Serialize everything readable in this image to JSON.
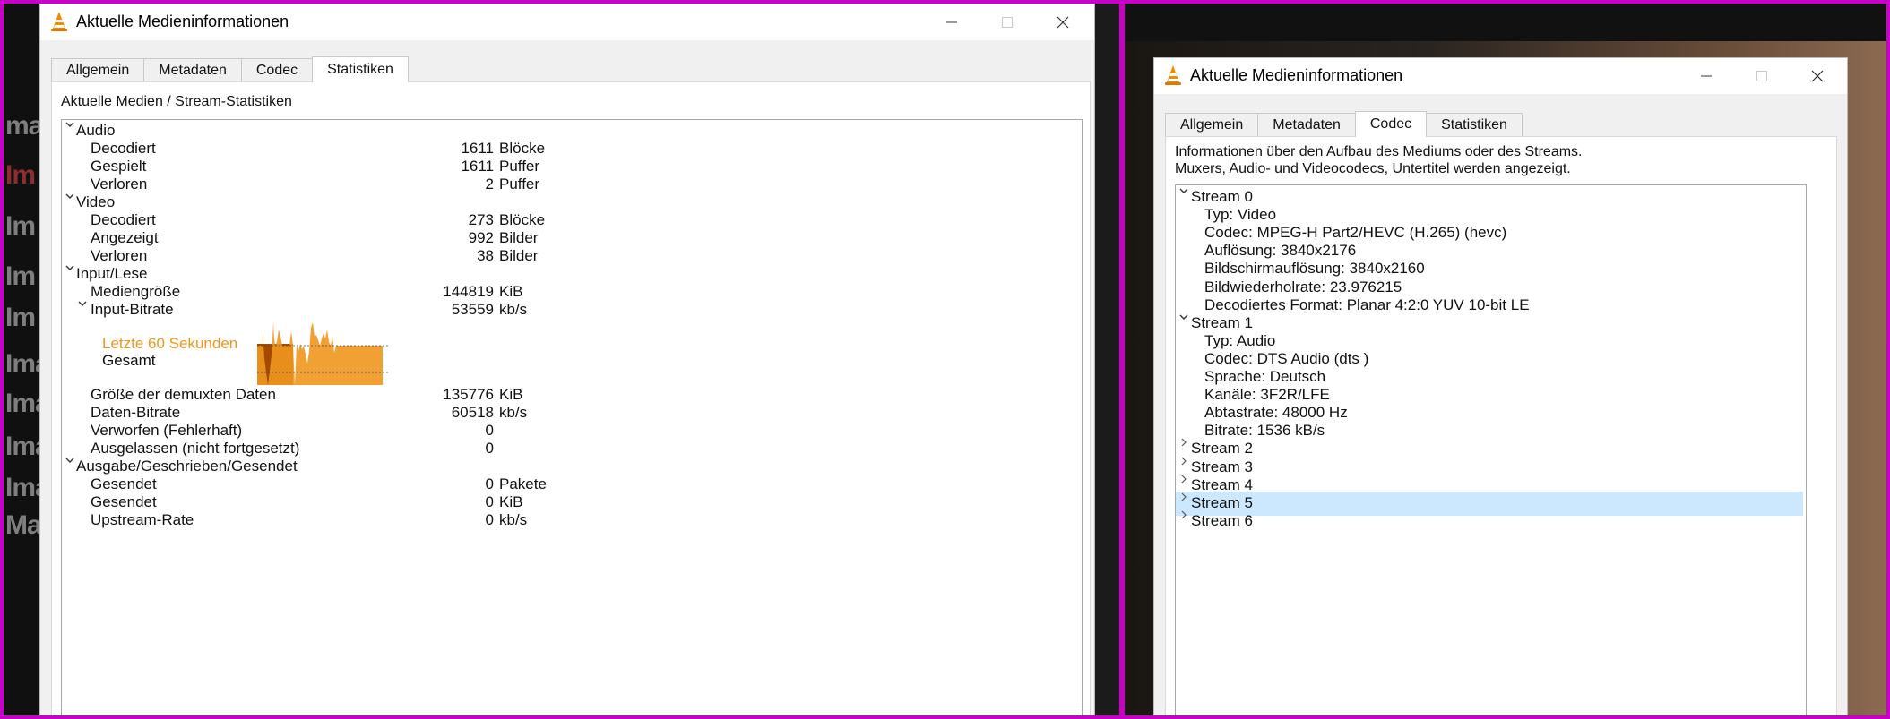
{
  "left_window": {
    "title": "Aktuelle Medieninformationen",
    "tabs": [
      "Allgemein",
      "Metadaten",
      "Codec",
      "Statistiken"
    ],
    "active_tab": "Statistiken",
    "section_title": "Aktuelle Medien / Stream-Statistiken",
    "groups": {
      "audio": {
        "label": "Audio",
        "rows": [
          {
            "label": "Decodiert",
            "value": "1611",
            "unit": "Blöcke"
          },
          {
            "label": "Gespielt",
            "value": "1611",
            "unit": "Puffer"
          },
          {
            "label": "Verloren",
            "value": "2",
            "unit": "Puffer"
          }
        ]
      },
      "video": {
        "label": "Video",
        "rows": [
          {
            "label": "Decodiert",
            "value": "273",
            "unit": "Blöcke"
          },
          {
            "label": "Angezeigt",
            "value": "992",
            "unit": "Bilder"
          },
          {
            "label": "Verloren",
            "value": "38",
            "unit": "Bilder"
          }
        ]
      },
      "input": {
        "label": "Input/Lese",
        "media_size": {
          "label": "Mediengröße",
          "value": "144819",
          "unit": "KiB"
        },
        "bitrate": {
          "label": "Input-Bitrate",
          "value": "53559",
          "unit": "kb/s"
        },
        "legend_recent": "Letzte 60 Sekunden",
        "legend_total": "Gesamt",
        "rows": [
          {
            "label": "Größe der demuxten Daten",
            "value": "135776",
            "unit": "KiB"
          },
          {
            "label": "Daten-Bitrate",
            "value": "60518",
            "unit": "kb/s"
          },
          {
            "label": "Verworfen (Fehlerhaft)",
            "value": "0",
            "unit": ""
          },
          {
            "label": "Ausgelassen (nicht fortgesetzt)",
            "value": "0",
            "unit": ""
          }
        ]
      },
      "output": {
        "label": "Ausgabe/Geschrieben/Gesendet",
        "rows": [
          {
            "label": "Gesendet",
            "value": "0",
            "unit": "Pakete"
          },
          {
            "label": "Gesendet",
            "value": "0",
            "unit": "KiB"
          },
          {
            "label": "Upstream-Rate",
            "value": "0",
            "unit": "kb/s"
          }
        ]
      }
    }
  },
  "background_text": [
    "mag",
    "Im",
    "Im",
    "Im",
    "Im",
    "Ima",
    "Ima",
    "Ima",
    "Ima",
    "Ma"
  ],
  "right_window": {
    "title": "Aktuelle Medieninformationen",
    "tabs": [
      "Allgemein",
      "Metadaten",
      "Codec",
      "Statistiken"
    ],
    "active_tab": "Codec",
    "info_line1": "Informationen über den Aufbau des Mediums oder des Streams.",
    "info_line2": "Muxers, Audio- und Videocodecs, Untertitel werden angezeigt.",
    "streams": [
      {
        "label": "Stream 0",
        "expanded": true,
        "details": [
          "Typ: Video",
          "Codec: MPEG-H Part2/HEVC (H.265) (hevc)",
          "Auflösung: 3840x2176",
          "Bildschirmauflösung: 3840x2160",
          "Bildwiederholrate: 23.976215",
          "Decodiertes Format: Planar 4:2:0 YUV 10-bit LE"
        ]
      },
      {
        "label": "Stream 1",
        "expanded": true,
        "details": [
          "Typ: Audio",
          "Codec: DTS Audio (dts )",
          "Sprache: Deutsch",
          "Kanäle: 3F2R/LFE",
          "Abtastrate: 48000 Hz",
          "Bitrate: 1536 kB/s"
        ]
      },
      {
        "label": "Stream 2",
        "expanded": false,
        "details": []
      },
      {
        "label": "Stream 3",
        "expanded": false,
        "details": []
      },
      {
        "label": "Stream 4",
        "expanded": false,
        "details": []
      },
      {
        "label": "Stream 5",
        "expanded": false,
        "selected": true,
        "details": []
      },
      {
        "label": "Stream 6",
        "expanded": false,
        "details": []
      }
    ]
  },
  "colors": {
    "frame": "#c800c8",
    "graph_recent": "#f0961e",
    "graph_total": "#a04400",
    "selection": "#cce8ff"
  }
}
